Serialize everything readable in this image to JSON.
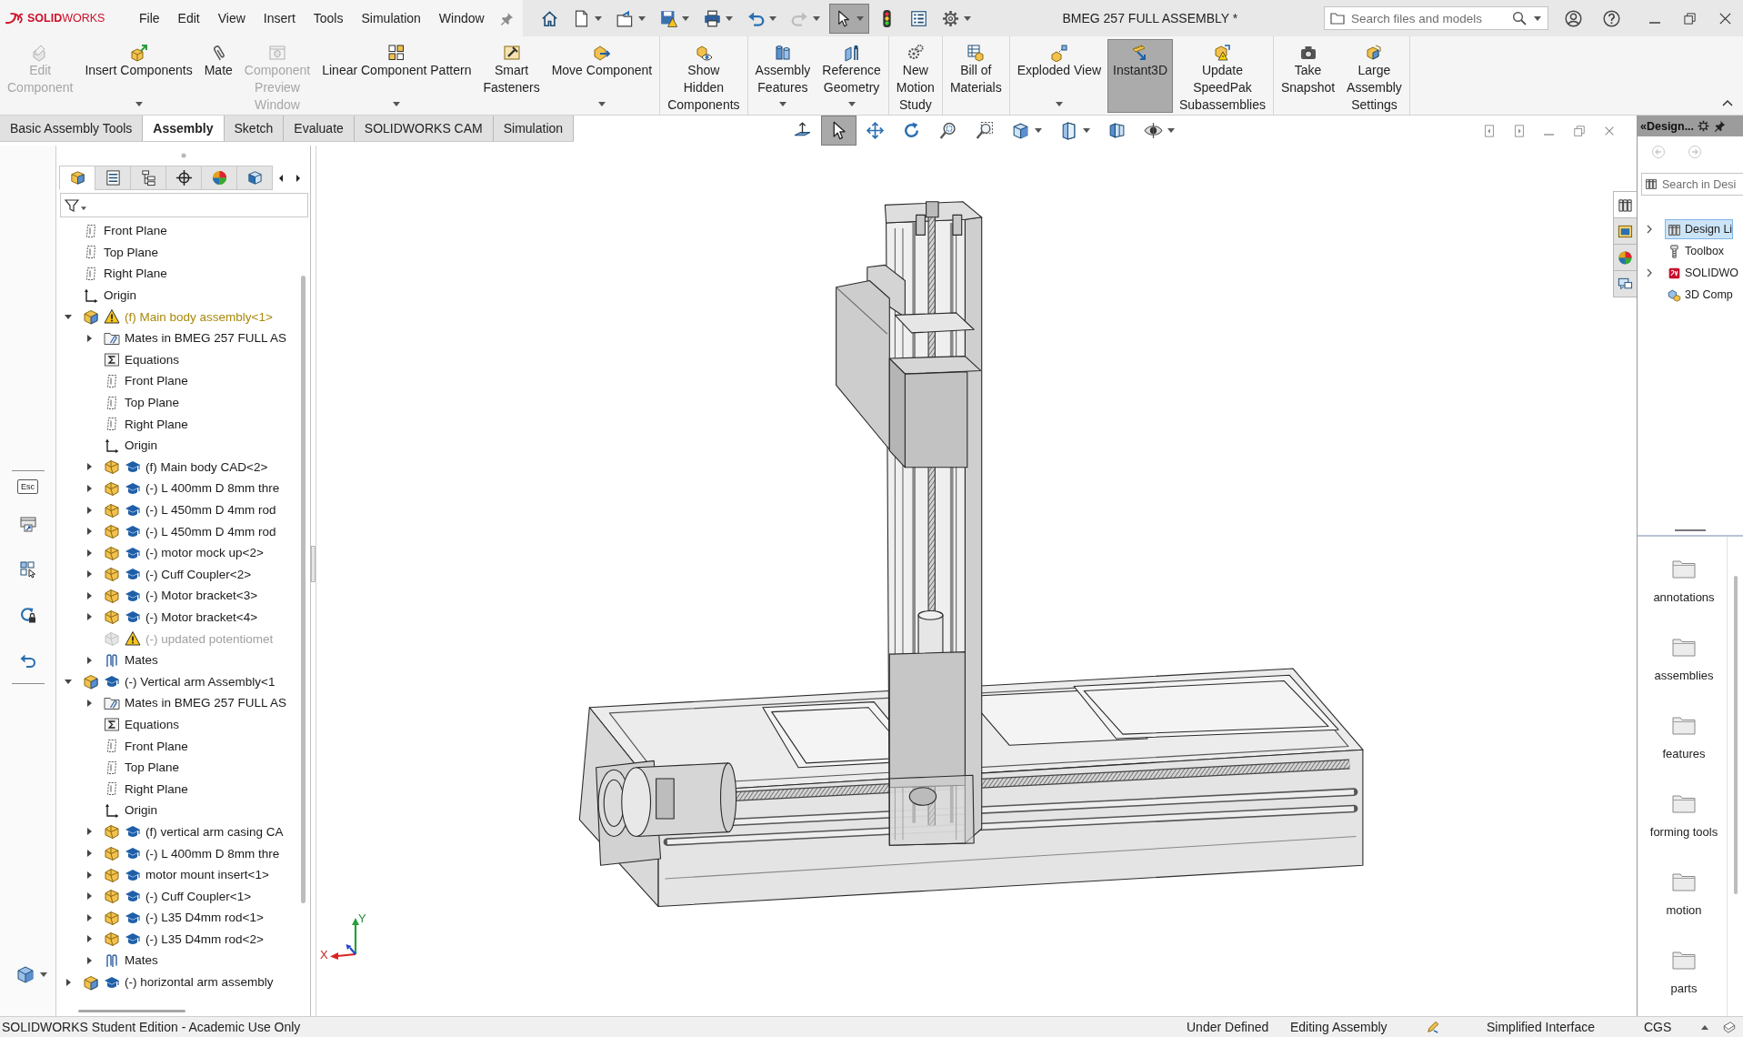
{
  "app": {
    "logo_text": "**SOLID**WORKS"
  },
  "menu": [
    "File",
    "Edit",
    "View",
    "Insert",
    "Tools",
    "Simulation",
    "Window"
  ],
  "quick_access": [
    {
      "kind": "home",
      "dropdown": false,
      "disabled": false,
      "pressed": false
    },
    {
      "kind": "new",
      "dropdown": true,
      "disabled": false,
      "pressed": false
    },
    {
      "kind": "open",
      "dropdown": true,
      "disabled": false,
      "pressed": false
    },
    {
      "kind": "save",
      "dropdown": true,
      "disabled": false,
      "pressed": false
    },
    {
      "kind": "print",
      "dropdown": true,
      "disabled": false,
      "pressed": false
    },
    {
      "kind": "undo",
      "dropdown": true,
      "disabled": false,
      "pressed": false
    },
    {
      "kind": "redo",
      "dropdown": true,
      "disabled": true,
      "pressed": false
    },
    {
      "kind": "select",
      "dropdown": true,
      "disabled": false,
      "pressed": true
    },
    {
      "kind": "rebuild",
      "dropdown": false,
      "disabled": false,
      "pressed": false
    },
    {
      "kind": "file-properties",
      "dropdown": false,
      "disabled": false,
      "pressed": false
    },
    {
      "kind": "options",
      "dropdown": true,
      "disabled": false,
      "pressed": false
    }
  ],
  "title": "BMEG 257 FULL ASSEMBLY *",
  "search": {
    "placeholder": "Search files and models"
  },
  "ribbon": {
    "groups": [
      [
        {
          "label": "Edit\nComponent",
          "kind": "edit-component",
          "dropdown": false,
          "disabled": true,
          "pressed": false
        },
        {
          "label": "Insert Components",
          "kind": "insert-components",
          "dropdown": true,
          "disabled": false,
          "pressed": false
        },
        {
          "label": "Mate",
          "kind": "mate",
          "dropdown": false,
          "disabled": false,
          "pressed": false
        },
        {
          "label": "Component\nPreview\nWindow",
          "kind": "component-preview",
          "dropdown": false,
          "disabled": true,
          "pressed": false
        },
        {
          "label": "Linear Component Pattern",
          "kind": "linear-pattern",
          "dropdown": true,
          "disabled": false,
          "pressed": false
        },
        {
          "label": "Smart\nFasteners",
          "kind": "smart-fasteners",
          "dropdown": false,
          "disabled": false,
          "pressed": false
        },
        {
          "label": "Move Component",
          "kind": "move-component",
          "dropdown": true,
          "disabled": false,
          "pressed": false
        }
      ],
      [
        {
          "label": "Show\nHidden\nComponents",
          "kind": "show-hidden",
          "dropdown": false,
          "disabled": false,
          "pressed": false
        }
      ],
      [
        {
          "label": "Assembly\nFeatures",
          "kind": "assembly-features",
          "dropdown": true,
          "disabled": false,
          "pressed": false
        },
        {
          "label": "Reference\nGeometry",
          "kind": "reference-geometry",
          "dropdown": true,
          "disabled": false,
          "pressed": false
        }
      ],
      [
        {
          "label": "New\nMotion\nStudy",
          "kind": "motion-study",
          "dropdown": false,
          "disabled": false,
          "pressed": false
        }
      ],
      [
        {
          "label": "Bill of\nMaterials",
          "kind": "bill-of-materials",
          "dropdown": false,
          "disabled": false,
          "pressed": false
        }
      ],
      [
        {
          "label": "Exploded View",
          "kind": "exploded-view",
          "dropdown": true,
          "disabled": false,
          "pressed": false
        },
        {
          "label": "Instant3D",
          "kind": "instant3d",
          "dropdown": false,
          "disabled": false,
          "pressed": true
        },
        {
          "label": "Update\nSpeedPak\nSubassemblies",
          "kind": "speedpak",
          "dropdown": false,
          "disabled": false,
          "pressed": false
        }
      ],
      [
        {
          "label": "Take\nSnapshot",
          "kind": "snapshot",
          "dropdown": false,
          "disabled": false,
          "pressed": false
        },
        {
          "label": "Large\nAssembly\nSettings",
          "kind": "large-assembly",
          "dropdown": false,
          "disabled": false,
          "pressed": false
        }
      ]
    ]
  },
  "tabs": [
    {
      "label": "Basic Assembly Tools",
      "selected": false
    },
    {
      "label": "Assembly",
      "selected": true
    },
    {
      "label": "Sketch",
      "selected": false
    },
    {
      "label": "Evaluate",
      "selected": false
    },
    {
      "label": "SOLIDWORKS CAM",
      "selected": false
    },
    {
      "label": "Simulation",
      "selected": false
    }
  ],
  "view_toolbar": [
    {
      "kind": "normal-to",
      "dropdown": false,
      "pressed": false
    },
    {
      "kind": "select",
      "dropdown": false,
      "pressed": true
    },
    {
      "kind": "pan",
      "dropdown": false,
      "pressed": false
    },
    {
      "kind": "rotate",
      "dropdown": false,
      "pressed": false
    },
    {
      "kind": "zoom-fit",
      "dropdown": false,
      "pressed": false
    },
    {
      "kind": "zoom-area",
      "dropdown": false,
      "pressed": false
    },
    {
      "kind": "view-orientation",
      "dropdown": true,
      "pressed": false
    },
    {
      "kind": "display-style",
      "dropdown": true,
      "pressed": false
    },
    {
      "kind": "section-view",
      "dropdown": false,
      "pressed": false
    },
    {
      "kind": "hide-show",
      "dropdown": true,
      "pressed": false
    }
  ],
  "left_strip": {
    "esc_label": "Esc"
  },
  "feature_manager": {
    "tabs": [
      {
        "kind": "feature-manager",
        "selected": true
      },
      {
        "kind": "property-manager",
        "selected": false
      },
      {
        "kind": "configuration-manager",
        "selected": false
      },
      {
        "kind": "dimxpert-manager",
        "selected": false
      },
      {
        "kind": "display-manager",
        "selected": false
      },
      {
        "kind": "cam-manager",
        "selected": false
      }
    ],
    "tree": [
      {
        "label": "Front Plane",
        "kind": "plane",
        "warning": false,
        "educational": false,
        "suppressed": false
      },
      {
        "label": "Top Plane",
        "kind": "plane",
        "warning": false,
        "educational": false,
        "suppressed": false
      },
      {
        "label": "Right Plane",
        "kind": "plane",
        "warning": false,
        "educational": false,
        "suppressed": false
      },
      {
        "label": "Origin",
        "kind": "origin",
        "warning": false,
        "educational": false,
        "suppressed": false
      },
      {
        "label": "(f) Main body assembly<1>",
        "kind": "assembly",
        "warning": true,
        "educational": false,
        "suppressed": false,
        "expanded": true,
        "children": [
          {
            "label": "Mates in BMEG 257 FULL AS",
            "kind": "mates-folder",
            "warning": false,
            "educational": false,
            "suppressed": false,
            "expanded": false
          },
          {
            "label": "Equations",
            "kind": "equations",
            "warning": false,
            "educational": false,
            "suppressed": false
          },
          {
            "label": "Front Plane",
            "kind": "plane",
            "warning": false,
            "educational": false,
            "suppressed": false
          },
          {
            "label": "Top Plane",
            "kind": "plane",
            "warning": false,
            "educational": false,
            "suppressed": false
          },
          {
            "label": "Right Plane",
            "kind": "plane",
            "warning": false,
            "educational": false,
            "suppressed": false
          },
          {
            "label": "Origin",
            "kind": "origin",
            "warning": false,
            "educational": false,
            "suppressed": false
          },
          {
            "label": "(f) Main body CAD<2>",
            "kind": "part",
            "warning": false,
            "educational": true,
            "suppressed": false,
            "expanded": false
          },
          {
            "label": "(-) L 400mm D 8mm thre",
            "kind": "part",
            "warning": false,
            "educational": true,
            "suppressed": false,
            "expanded": false
          },
          {
            "label": "(-) L 450mm D 4mm rod",
            "kind": "part",
            "warning": false,
            "educational": true,
            "suppressed": false,
            "expanded": false
          },
          {
            "label": "(-) L 450mm D 4mm rod",
            "kind": "part",
            "warning": false,
            "educational": true,
            "suppressed": false,
            "expanded": false
          },
          {
            "label": "(-) motor mock up<2>",
            "kind": "part",
            "warning": false,
            "educational": true,
            "suppressed": false,
            "expanded": false
          },
          {
            "label": "(-) Cuff Coupler<2>",
            "kind": "part",
            "warning": false,
            "educational": true,
            "suppressed": false,
            "expanded": false
          },
          {
            "label": "(-) Motor bracket<3>",
            "kind": "part",
            "warning": false,
            "educational": true,
            "suppressed": false,
            "expanded": false
          },
          {
            "label": "(-) Motor bracket<4>",
            "kind": "part",
            "warning": false,
            "educational": true,
            "suppressed": false,
            "expanded": false
          },
          {
            "label": "(-) updated potentiomet",
            "kind": "part",
            "warning": true,
            "educational": false,
            "suppressed": true
          },
          {
            "label": "Mates",
            "kind": "mates",
            "warning": false,
            "educational": false,
            "suppressed": false,
            "expanded": false
          }
        ]
      },
      {
        "label": "(-) Vertical arm Assembly<1",
        "kind": "assembly",
        "warning": false,
        "educational": true,
        "suppressed": false,
        "expanded": true,
        "children": [
          {
            "label": "Mates in BMEG 257 FULL AS",
            "kind": "mates-folder",
            "warning": false,
            "educational": false,
            "suppressed": false,
            "expanded": false
          },
          {
            "label": "Equations",
            "kind": "equations",
            "warning": false,
            "educational": false,
            "suppressed": false
          },
          {
            "label": "Front Plane",
            "kind": "plane",
            "warning": false,
            "educational": false,
            "suppressed": false
          },
          {
            "label": "Top Plane",
            "kind": "plane",
            "warning": false,
            "educational": false,
            "suppressed": false
          },
          {
            "label": "Right Plane",
            "kind": "plane",
            "warning": false,
            "educational": false,
            "suppressed": false
          },
          {
            "label": "Origin",
            "kind": "origin",
            "warning": false,
            "educational": false,
            "suppressed": false
          },
          {
            "label": "(f) vertical arm casing CA",
            "kind": "part",
            "warning": false,
            "educational": true,
            "suppressed": false,
            "expanded": false
          },
          {
            "label": "(-) L 400mm D 8mm thre",
            "kind": "part",
            "warning": false,
            "educational": true,
            "suppressed": false,
            "expanded": false
          },
          {
            "label": "motor mount insert<1>",
            "kind": "part",
            "warning": false,
            "educational": true,
            "suppressed": false,
            "expanded": false
          },
          {
            "label": "(-) Cuff Coupler<1>",
            "kind": "part",
            "warning": false,
            "educational": true,
            "suppressed": false,
            "expanded": false
          },
          {
            "label": "(-) L35 D4mm rod<1>",
            "kind": "part",
            "warning": false,
            "educational": true,
            "suppressed": false,
            "expanded": false
          },
          {
            "label": "(-) L35 D4mm rod<2>",
            "kind": "part",
            "warning": false,
            "educational": true,
            "suppressed": false,
            "expanded": false
          },
          {
            "label": "Mates",
            "kind": "mates",
            "warning": false,
            "educational": false,
            "suppressed": false,
            "expanded": false
          }
        ]
      },
      {
        "label": "(-) horizontal arm assembly",
        "kind": "assembly",
        "warning": false,
        "educational": true,
        "suppressed": false,
        "expanded": false
      }
    ]
  },
  "triad": {
    "x_label": "X",
    "y_label": "Y"
  },
  "task_pane": {
    "tabs": [
      {
        "kind": "design-library",
        "selected": true
      },
      {
        "kind": "file-explorer",
        "selected": false
      },
      {
        "kind": "appearances",
        "selected": false
      },
      {
        "kind": "custom-properties",
        "selected": false
      }
    ],
    "title": "«Design...",
    "search": {
      "placeholder": "Search in Desi"
    },
    "tree": [
      {
        "label": "Design Li",
        "kind": "design-library",
        "selected": true,
        "expanded": false
      },
      {
        "label": "Toolbox",
        "kind": "toolbox",
        "selected": false
      },
      {
        "label": "SOLIDWO",
        "kind": "sw-content",
        "selected": false,
        "expanded": false
      },
      {
        "label": "3D Comp",
        "kind": "cad-content",
        "selected": false
      }
    ],
    "folders": [
      "annotations",
      "assemblies",
      "features",
      "forming tools",
      "motion",
      "parts"
    ]
  },
  "status_bar": {
    "message": "SOLIDWORKS Student Edition - Academic Use Only",
    "fields": [
      "Under Defined",
      "Editing Assembly",
      "Simplified Interface",
      "CGS"
    ]
  }
}
